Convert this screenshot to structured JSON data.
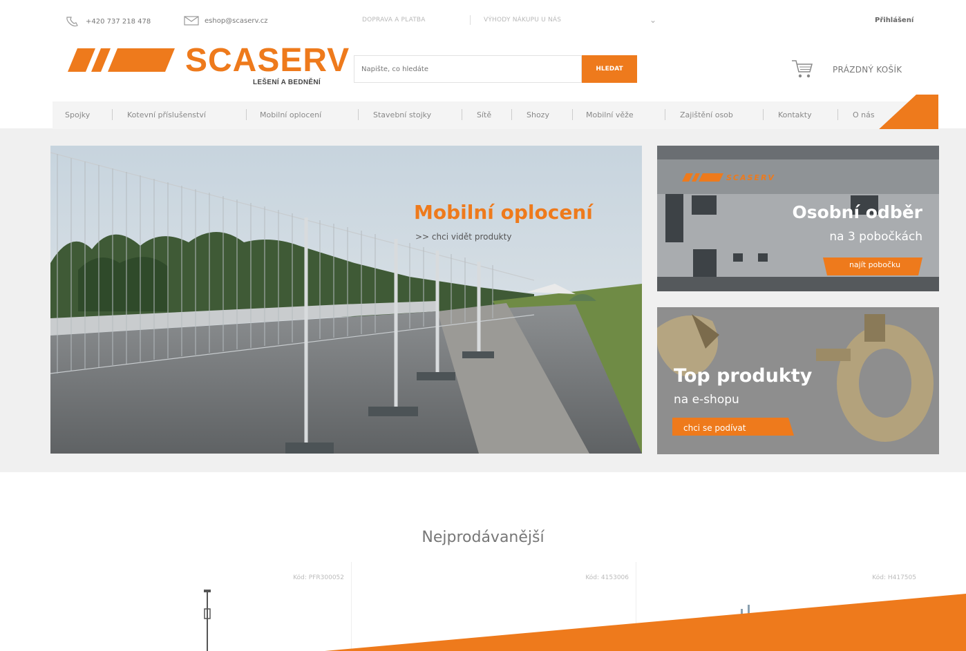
{
  "topbar": {
    "phone": "+420 737 218 478",
    "email": "eshop@scaserv.cz",
    "links": [
      "DOPRAVA A PLATBA",
      "VÝHODY NÁKUPU U NÁS"
    ],
    "login": "Přihlášení"
  },
  "header": {
    "logo_name": "SCASERV",
    "logo_tagline": "LEŠENÍ A BEDNĚNÍ",
    "search_placeholder": "Napište, co hledáte",
    "search_button": "HLEDAT",
    "cart_label": "PRÁZDNÝ KOŠÍK"
  },
  "nav": {
    "items": [
      "Spojky",
      "Kotevní příslušenství",
      "Mobilní oplocení",
      "Stavební stojky",
      "Sítě",
      "Shozy",
      "Mobilní věže",
      "Zajištění osob",
      "Kontakty",
      "O nás"
    ]
  },
  "banner": {
    "title": "Mobilní oplocení",
    "link": ">> chci vidět produkty"
  },
  "side_top": {
    "title": "Osobní odběr",
    "subtitle": "na 3 pobočkách",
    "button": "najít pobočku",
    "sign_text": "SCASERV"
  },
  "side_bottom": {
    "title": "Top produkty",
    "subtitle": "na e-shopu",
    "button": "chci se podívat"
  },
  "bestsellers": {
    "title": "Nejprodávanější",
    "products": [
      {
        "code": "Kód: PFR300052"
      },
      {
        "code": "Kód: 4153006"
      },
      {
        "code": "Kód: H417505"
      }
    ]
  },
  "colors": {
    "accent": "#ee7a1c",
    "text": "#666666",
    "background": "#f2f2f2"
  }
}
